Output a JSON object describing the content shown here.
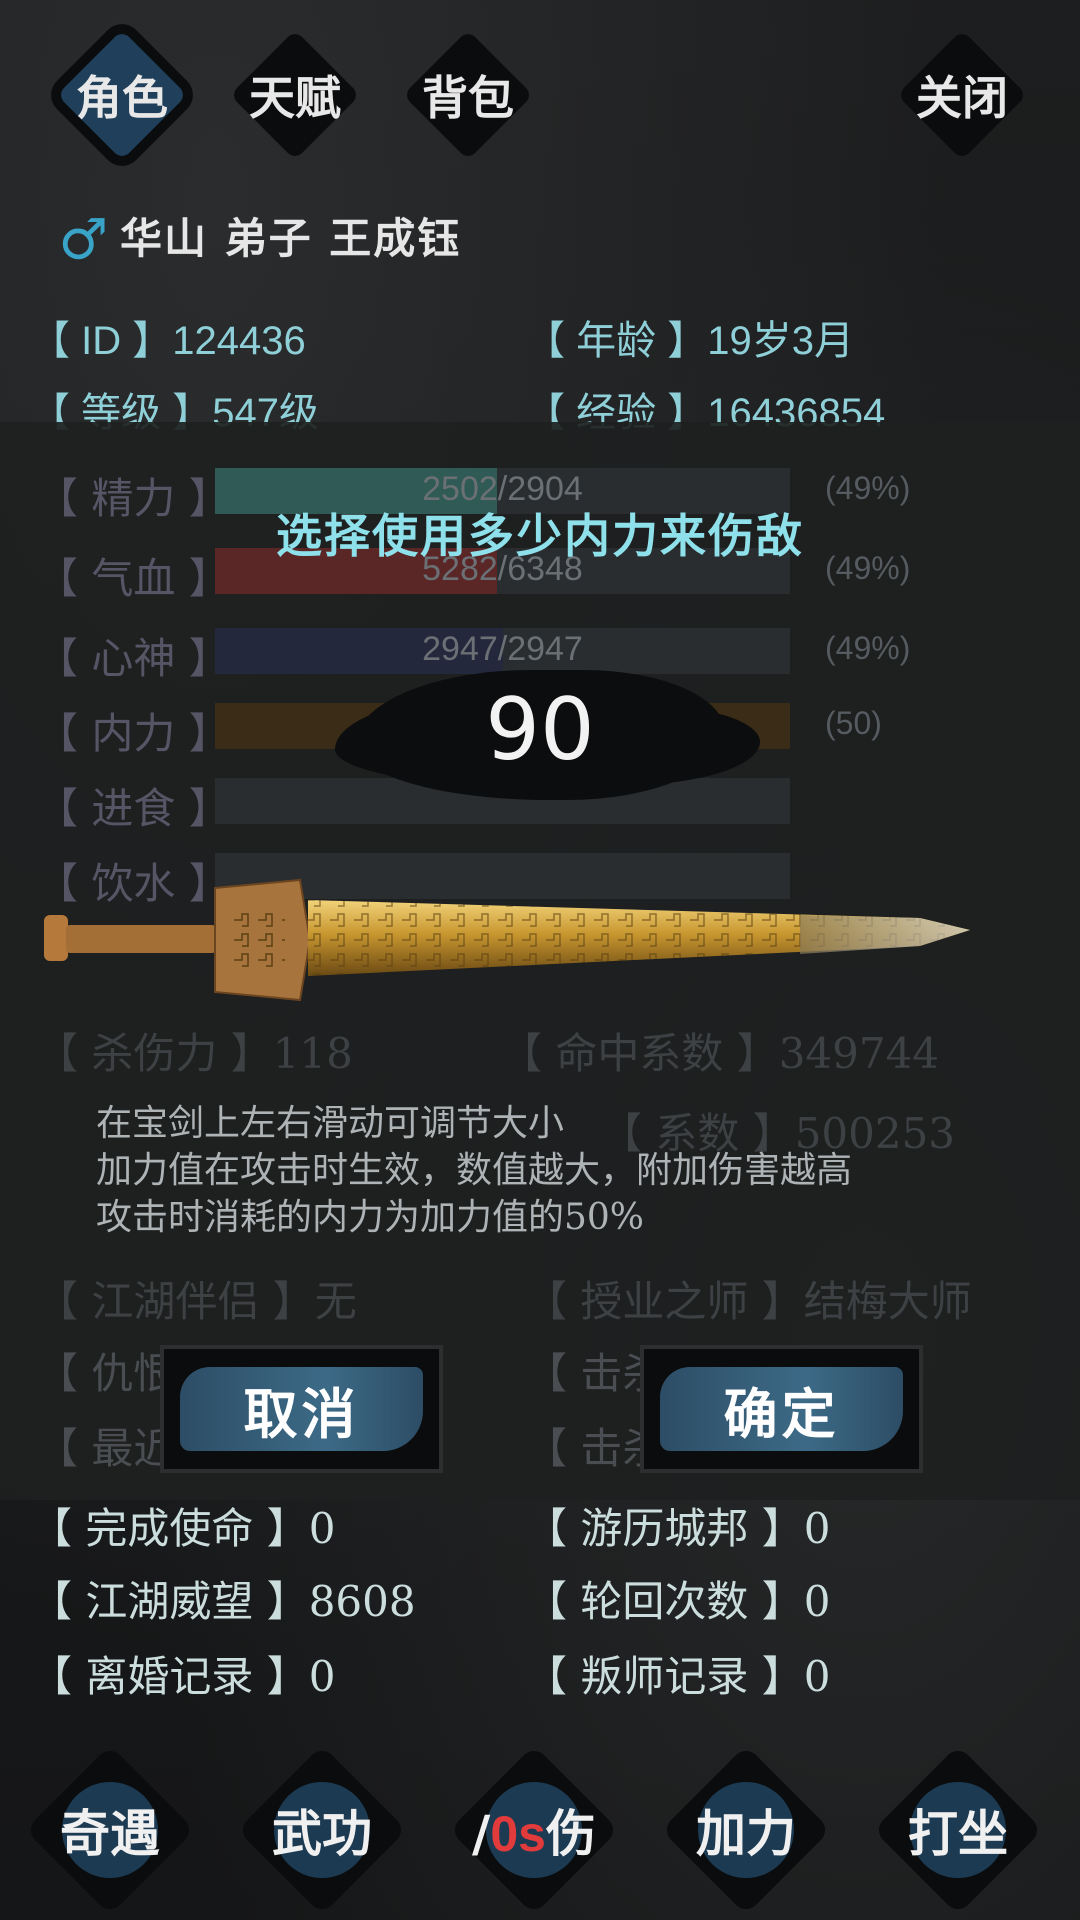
{
  "tabs": {
    "role": "角色",
    "talent": "天赋",
    "bag": "背包",
    "close": "关闭"
  },
  "character": {
    "gender_symbol": "♂",
    "name": "华山 弟子 王成钰",
    "id_label": "【  ID  】124436",
    "age_label": "【 年龄 】19岁3月",
    "level_label": "【 等级 】547级",
    "exp_label": "【 经验 】16436854"
  },
  "stats": {
    "jingli": {
      "label": "【 精力 】",
      "text": "2502/2904",
      "pct": "(49%)",
      "fill": 0.49,
      "color": "#2f5a55"
    },
    "qixue": {
      "label": "【 气血 】",
      "text": "5282/6348",
      "pct": "(49%)",
      "fill": 0.49,
      "color": "#5a2626"
    },
    "xinshen": {
      "label": "【 心神 】",
      "text": "2947/2947",
      "pct": "(49%)",
      "fill": 0.5,
      "color": "#24283c"
    },
    "neili": {
      "label": "【 内力 】",
      "text": "",
      "pct": "(50)",
      "fill": 1.0,
      "color": "#3a2c16"
    },
    "jinshi": {
      "label": "【 进食 】"
    },
    "yinshui": {
      "label": "【 饮水 】"
    }
  },
  "background_rows": {
    "shashang": "【 杀伤力 】118",
    "mingzhong": "【 命中系数 】349744",
    "xishu2": "【 系数 】500253",
    "jianghu_partner": "【 江湖伴侣 】无",
    "teacher": "【 授业之师 】结梅大师",
    "enemy": "【 仇恨",
    "kill1": "【 击杀",
    "recent": "【 最近",
    "kill2": "【 击杀",
    "mission": "【 完成使命 】0",
    "travel": "【 游历城邦 】0",
    "prestige": "【 江湖威望 】8608",
    "rebirth": "【 轮回次数 】0",
    "divorce": "【 离婚记录 】0",
    "betray": "【 叛师记录 】0"
  },
  "dialog": {
    "title": "选择使用多少内力来伤敌",
    "value": "90",
    "help_line1": "在宝剑上左右滑动可调节大小",
    "help_line2": "加力值在攻击时生效，数值越大，附加伤害越高",
    "help_line3": "攻击时消耗的内力为加力值的50%",
    "cancel": "取消",
    "confirm": "确定"
  },
  "bottom_nav": {
    "qiyu": "奇遇",
    "wugong": "武功",
    "liaoshang_prefix": "/",
    "liaoshang_timer": "0s",
    "liaoshang_suffix": "伤",
    "jiali": "加力",
    "dazuo": "打坐"
  }
}
